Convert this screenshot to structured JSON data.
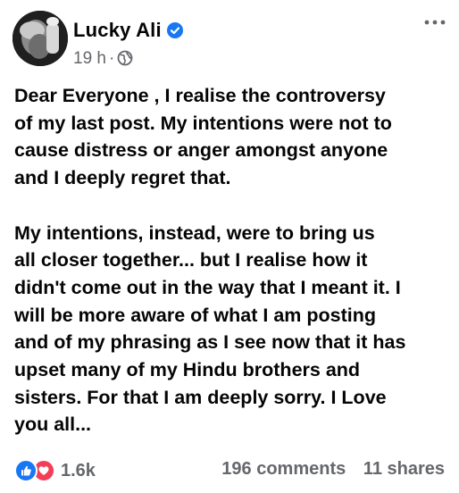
{
  "post": {
    "author": "Lucky Ali",
    "verified_icon": "verified-badge-icon",
    "time": "19 h",
    "separator": "·",
    "audience_icon": "globe-icon",
    "more_icon": "more-options-icon",
    "paragraphs": [
      "Dear Everyone , I realise the controversy\nof my last post. My intentions were not to\ncause distress or anger amongst anyone\nand I deeply regret that.",
      " My intentions, instead, were to bring us\nall closer together... but I realise how it\ndidn't come out in the way that I meant it. I\nwill be more aware of what I am posting\nand of my phrasing as I see now that it has\nupset many of my Hindu brothers  and\nsisters. For that I am deeply sorry. I Love\nyou all..."
    ]
  },
  "footer": {
    "reaction_icons": [
      "like-icon",
      "love-icon"
    ],
    "reaction_count": "1.6k",
    "comments": "196 comments",
    "shares": "11 shares"
  },
  "colors": {
    "text": "#050505",
    "secondary": "#65676b",
    "like_blue": "#1877f2",
    "love_red": "#f33e58",
    "verified_blue": "#1877f2"
  }
}
